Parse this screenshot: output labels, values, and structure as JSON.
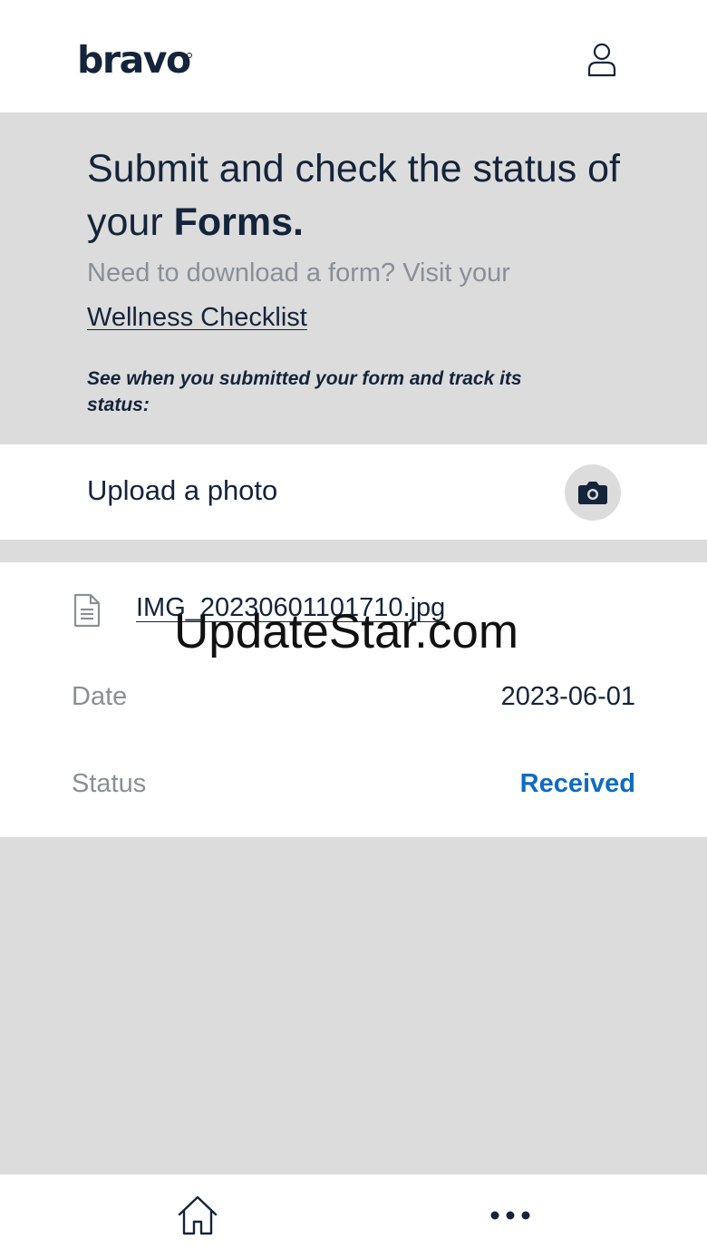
{
  "header": {
    "logo_text": "bravo",
    "profile_icon": "user-icon"
  },
  "intro": {
    "headline_plain": "Submit and check the status of your ",
    "headline_bold": "Forms.",
    "download_prompt": "Need to download a form? Visit your",
    "checklist_link": "Wellness Checklist",
    "track_note": "See when you submitted your form and track its status:"
  },
  "upload": {
    "label": "Upload a photo",
    "icon": "camera-icon"
  },
  "form_item": {
    "file_icon": "document-icon",
    "file_name": "IMG_20230601101710.jpg",
    "date_label": "Date",
    "date_value": "2023-06-01",
    "status_label": "Status",
    "status_value": "Received"
  },
  "watermark": "UpdateStar.com",
  "bottom_nav": {
    "home_icon": "home-icon",
    "more_icon": "more-icon"
  },
  "colors": {
    "primary_text": "#14243a",
    "muted_text": "#8a8f96",
    "status_received": "#0d6cc4",
    "panel_gray": "#dcdcdc",
    "surface": "#ffffff"
  }
}
